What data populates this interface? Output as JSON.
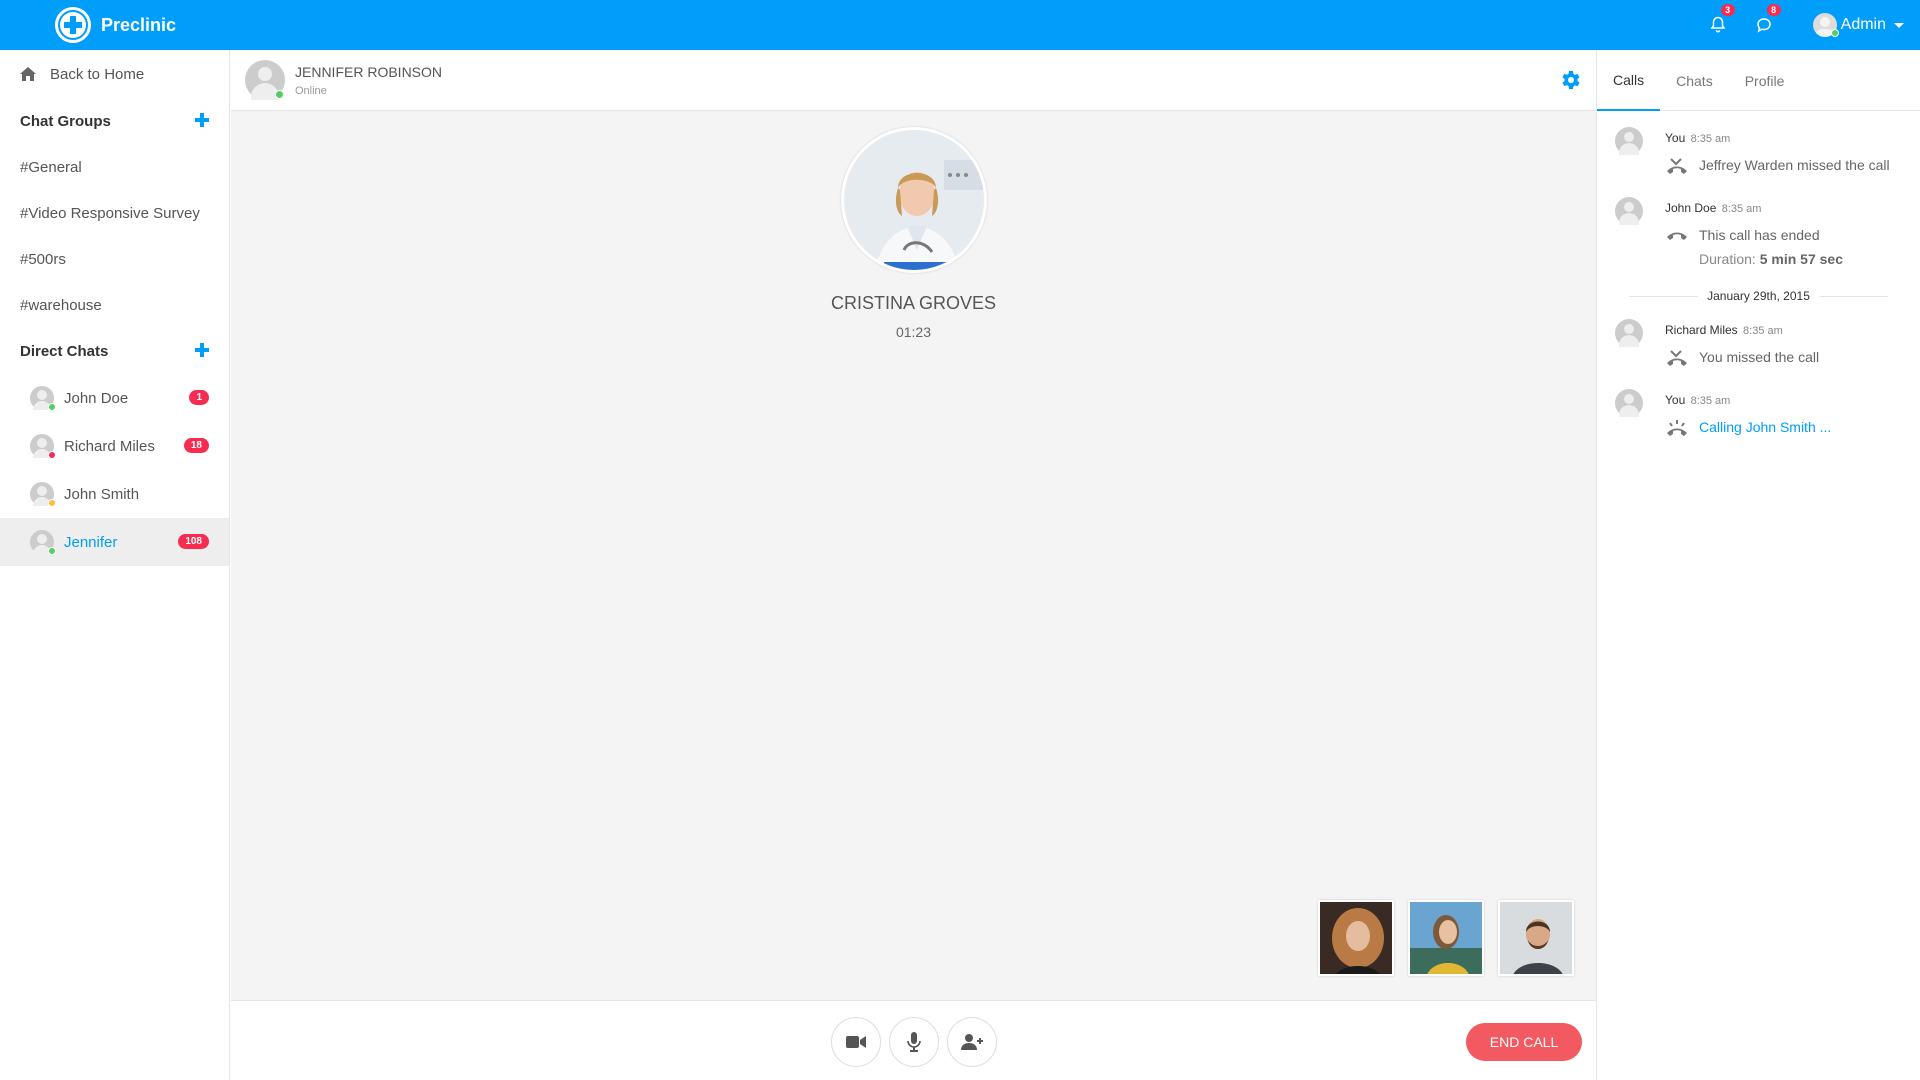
{
  "header": {
    "brand": "Preclinic",
    "notifications_count": "3",
    "messages_count": "8",
    "user_name": "Admin"
  },
  "sidebar": {
    "back_home": "Back to Home",
    "chat_groups_title": "Chat Groups",
    "groups": [
      "#General",
      "#Video Responsive Survey",
      "#500rs",
      "#warehouse"
    ],
    "direct_chats_title": "Direct Chats",
    "direct": [
      {
        "name": "John Doe",
        "badge": "1",
        "status_color": "#55ce63"
      },
      {
        "name": "Richard Miles",
        "badge": "18",
        "status_color": "#f62d51"
      },
      {
        "name": "John Smith",
        "badge": "",
        "status_color": "#ffbc34"
      },
      {
        "name": "Jennifer",
        "badge": "108",
        "status_color": "#55ce63"
      }
    ]
  },
  "chat": {
    "contact_name": "JENNIFER ROBINSON",
    "contact_status": "Online",
    "caller_name": "CRISTINA GROVES",
    "timer": "01:23",
    "end_call_label": "END CALL"
  },
  "right": {
    "tabs": [
      "Calls",
      "Chats",
      "Profile"
    ],
    "log": [
      {
        "who": "You",
        "time": "8:35 am",
        "msg": "Jeffrey Warden missed the call",
        "icon": "missed-call-icon"
      },
      {
        "who": "John Doe",
        "time": "8:35 am",
        "msg": "This call has ended",
        "duration_label": "Duration:",
        "duration_value": "5 min 57 sec",
        "icon": "call-ended-icon"
      },
      {
        "who": "Richard Miles",
        "time": "8:35 am",
        "msg": "You missed the call",
        "icon": "missed-call-icon"
      },
      {
        "who": "You",
        "time": "8:35 am",
        "msg": "Calling John Smith ...",
        "icon": "calling-icon"
      }
    ],
    "date_divider": "January 29th, 2015"
  },
  "colors": {
    "brand": "#009efb",
    "danger": "#f62d51",
    "end_call": "#f25961",
    "online": "#55ce63"
  }
}
